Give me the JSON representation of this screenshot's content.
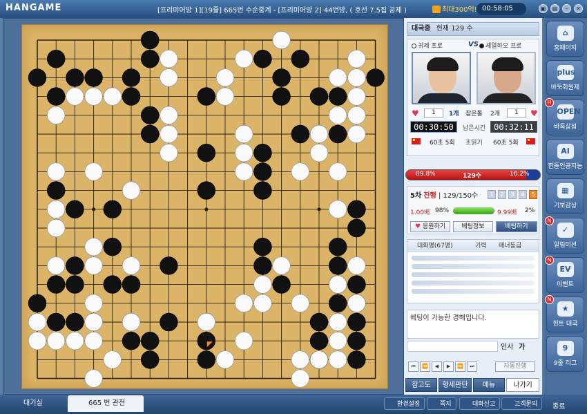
{
  "app": {
    "logo": "HANGAME",
    "title": "[프리미어방 1][19줄] 665번 수순중계 - [프리미어방 2] 44번방, ( 호선 7.5집 공제 )",
    "badge": "최대300억!",
    "clock": "00:58:05",
    "win_buttons": [
      "▣",
      "▤",
      "–",
      "✕"
    ]
  },
  "board": {
    "size": 19,
    "black": [
      [
        13,
        0
      ],
      [
        1,
        1
      ],
      [
        6,
        1
      ],
      [
        12,
        1
      ],
      [
        14,
        1
      ],
      [
        0,
        2
      ],
      [
        2,
        2
      ],
      [
        3,
        2
      ],
      [
        5,
        2
      ],
      [
        13,
        2
      ],
      [
        18,
        2
      ],
      [
        1,
        3
      ],
      [
        5,
        3
      ],
      [
        9,
        3
      ],
      [
        13,
        3
      ],
      [
        15,
        3
      ],
      [
        16,
        3
      ],
      [
        9,
        4
      ],
      [
        6,
        5
      ],
      [
        16,
        5
      ],
      [
        6,
        6
      ],
      [
        14,
        6
      ],
      [
        16,
        6
      ],
      [
        9,
        7
      ],
      [
        12,
        7
      ],
      [
        12,
        8
      ],
      [
        12,
        9
      ],
      [
        1,
        10
      ],
      [
        9,
        10
      ],
      [
        12,
        10
      ],
      [
        2,
        11
      ],
      [
        4,
        11
      ],
      [
        17,
        11
      ],
      [
        17,
        12
      ],
      [
        4,
        13
      ],
      [
        12,
        13
      ],
      [
        16,
        13
      ],
      [
        2,
        14
      ],
      [
        12,
        14
      ],
      [
        16,
        14
      ],
      [
        7,
        15
      ],
      [
        16,
        15
      ],
      [
        1,
        16
      ],
      [
        2,
        16
      ],
      [
        4,
        16
      ],
      [
        5,
        16
      ],
      [
        6,
        16
      ],
      [
        7,
        16
      ],
      [
        13,
        16
      ],
      [
        17,
        16
      ],
      [
        0,
        17
      ],
      [
        16,
        17
      ],
      [
        17,
        17
      ],
      [
        1,
        18
      ],
      [
        2,
        18
      ],
      [
        7,
        18
      ],
      [
        15,
        18
      ],
      [
        17,
        18
      ],
      [
        5,
        19
      ],
      [
        6,
        19
      ],
      [
        9,
        19
      ],
      [
        15,
        19
      ],
      [
        17,
        19
      ],
      [
        6,
        20
      ],
      [
        8,
        20
      ],
      [
        9,
        20
      ],
      [
        15,
        20
      ],
      [
        17,
        20
      ],
      [
        6,
        21
      ],
      [
        9,
        21
      ],
      [
        14,
        21
      ]
    ],
    "white": [
      [
        11,
        1
      ],
      [
        17,
        1
      ],
      [
        7,
        2
      ],
      [
        10,
        2
      ],
      [
        16,
        2
      ],
      [
        17,
        2
      ],
      [
        7,
        3
      ],
      [
        10,
        3
      ],
      [
        11,
        3
      ],
      [
        2,
        4
      ],
      [
        3,
        4
      ],
      [
        4,
        4
      ],
      [
        16,
        4
      ],
      [
        2,
        5
      ],
      [
        10,
        5
      ],
      [
        16,
        5
      ],
      [
        7,
        6
      ],
      [
        17,
        6
      ],
      [
        7,
        7
      ],
      [
        12,
        7
      ],
      [
        15,
        7
      ],
      [
        17,
        7
      ],
      [
        11,
        8
      ],
      [
        7,
        9
      ],
      [
        11,
        9
      ],
      [
        1,
        10
      ],
      [
        3,
        10
      ],
      [
        14,
        10
      ],
      [
        15,
        10
      ],
      [
        11,
        11
      ],
      [
        1,
        12
      ],
      [
        2,
        12
      ],
      [
        6,
        12
      ],
      [
        1,
        13
      ],
      [
        16,
        13
      ],
      [
        1,
        14
      ],
      [
        2,
        14
      ],
      [
        6,
        15
      ],
      [
        1,
        16
      ],
      [
        12,
        16
      ],
      [
        13,
        16
      ],
      [
        17,
        16
      ],
      [
        12,
        17
      ],
      [
        17,
        17
      ],
      [
        3,
        18
      ],
      [
        11,
        18
      ],
      [
        12,
        18
      ],
      [
        15,
        18
      ],
      [
        0,
        19
      ],
      [
        3,
        19
      ],
      [
        6,
        19
      ],
      [
        9,
        19
      ],
      [
        16,
        19
      ],
      [
        0,
        20
      ],
      [
        1,
        20
      ],
      [
        2,
        20
      ],
      [
        3,
        20
      ],
      [
        11,
        20
      ],
      [
        16,
        20
      ],
      [
        17,
        20
      ],
      [
        4,
        21
      ],
      [
        10,
        21
      ],
      [
        15,
        21
      ],
      [
        16,
        21
      ],
      [
        17,
        21
      ],
      [
        3,
        22
      ],
      [
        14,
        22
      ]
    ],
    "last_move": [
      9,
      20
    ]
  },
  "side": {
    "status": {
      "label": "대국중",
      "moves": "현재 129 수"
    },
    "white_player": "귀제 프로",
    "black_player": "셰얼하오 프로",
    "vs": "VS",
    "captured": {
      "white": "1",
      "white_unit": "1개",
      "label": "잡은돌",
      "black_unit": "2개",
      "black": "1"
    },
    "time": {
      "white": "00:30:50",
      "black": "00:32:11",
      "label": "남은시간"
    },
    "byoyomi": {
      "white": "60초  5회",
      "label": "초읽기",
      "black": "60초  5회"
    },
    "winrate": {
      "left": "89.8%",
      "mid": "129수",
      "right": "10.2%",
      "red_fraction": 0.898
    },
    "bet": {
      "round": "5차",
      "round_status": "진행",
      "round_moves": "129/150수",
      "tabs": [
        "1",
        "2",
        "3",
        "4",
        "5"
      ],
      "left": "1.00배",
      "left_pct": "98%",
      "right": "9.99배",
      "right_pct": "2%",
      "fill": 0.98,
      "buttons": [
        "응원하기",
        "베팅정보",
        "베팅하기"
      ]
    },
    "chat": {
      "headers": [
        "대화명(67명)",
        "기력",
        "매너등급"
      ],
      "message": "베팅이 가능한 경해입니다.",
      "greet": "인사",
      "ka": "가"
    },
    "nav": {
      "buttons": [
        "⏮",
        "⏪",
        "◀",
        "▶",
        "⏩",
        "⏭"
      ],
      "auto": "자동진행"
    },
    "bottom": [
      "참고도",
      "형세판단",
      "메뉴",
      "나가기"
    ]
  },
  "rightbar": [
    {
      "label": "홈페이지",
      "icon": "⌂",
      "new": ""
    },
    {
      "label": "바둑회원제",
      "icon": "plus",
      "new": ""
    },
    {
      "label": "바둑상점",
      "icon": "OPEN",
      "new": "H"
    },
    {
      "label": "한돌인공지능",
      "icon": "AI",
      "new": ""
    },
    {
      "label": "기보감상",
      "icon": "▦",
      "new": ""
    },
    {
      "label": "알림미션",
      "icon": "✓",
      "new": "N"
    },
    {
      "label": "이벤트",
      "icon": "EV",
      "new": "N"
    },
    {
      "label": "힌트 대국",
      "icon": "★",
      "new": "N"
    },
    {
      "label": "9줄 리그",
      "icon": "9",
      "new": ""
    }
  ],
  "footer": {
    "tab1": "대기실",
    "tab2": "665 번 관전",
    "buttons": [
      "환경설정",
      "쪽지",
      "대화신고",
      "고객문의"
    ],
    "exit": "종료"
  },
  "colors": {
    "board": "#dcb467",
    "accent": "#2f5282"
  }
}
